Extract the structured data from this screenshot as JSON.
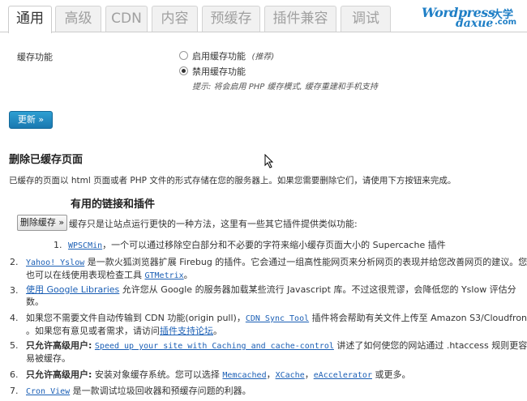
{
  "tabs": [
    "通用",
    "高级",
    "CDN",
    "内容",
    "预缓存",
    "插件兼容",
    "调试"
  ],
  "logo": {
    "line1": "Wordpress",
    "line2": "daxue",
    "cn": "大学",
    "dotcom": ".com"
  },
  "cache": {
    "label": "缓存功能",
    "opt_on": "启用缓存功能",
    "opt_on_note": "(推荐)",
    "opt_off": "禁用缓存功能",
    "hint": "提示: 将会启用 PHP 缓存模式, 缓存重建和手机支持"
  },
  "update_button": "更新 »",
  "delete_section": {
    "title": "删除已缓存页面",
    "desc": "已缓存的页面以 html 页面或者 PHP 文件的形式存储在您的服务器上。如果您需要删除它们，请使用下方按钮来完成。"
  },
  "links_section": {
    "title": "有用的链接和插件",
    "delete_button": "删除缓存 »",
    "intro": "缓存只是让站点运行更快的一种方法，这里有一些其它插件提供类似功能:"
  },
  "items": [
    {
      "n": "1.",
      "link": "WPSCMin",
      "text": "，一个可以通过移除空白部分和不必要的字符来缩小缓存页面大小的 Supercache 插件"
    },
    {
      "n": "2.",
      "link": "Yahoo! Yslow",
      "text1": " 是一款火狐浏览器扩展 Firebug 的插件。它会通过一组高性能网页来分析网页的表现并给您改善网页的建议。您",
      "text2": "也可以在线使用表现检查工具 ",
      "link2": "GTMetrix",
      "text3": "。"
    },
    {
      "n": "3.",
      "link": "使用 Google Libraries",
      "text1": " 允许您从 Google 的服务器加载某些流行 Javascript 库。不过这很荒谬，会降低您的 Yslow 评估分",
      "text2": "数。"
    },
    {
      "n": "4.",
      "pre": "如果您不需要文件自动传输到 CDN 功能(origin pull)，",
      "link": "CDN Sync Tool",
      "text1": " 插件将会帮助有关文件上传至 Amazon S3/Cloudfront",
      "text2": "。如果您有意见或者需求，请访问",
      "link2": "插件支持论坛",
      "text3": "。"
    },
    {
      "n": "5.",
      "bold": "只允许高级用户:",
      "link": "Speed up your site with Caching and cache-control",
      "text1": " 讲述了如何使您的网站通过 .htaccess 规则更容",
      "text2": "易被缓存。"
    },
    {
      "n": "6.",
      "bold": "只允许高级用户:",
      "pre": " 安装对象缓存系统。您可以选择 ",
      "l1": "Memcached",
      "sep1": "，",
      "l2": "XCache",
      "sep2": "，",
      "l3": "eAccelerator",
      "post": " 或更多。"
    },
    {
      "n": "7.",
      "link": "Cron View",
      "text": " 是一款调试垃圾回收器和预缓存问题的利器。"
    }
  ]
}
